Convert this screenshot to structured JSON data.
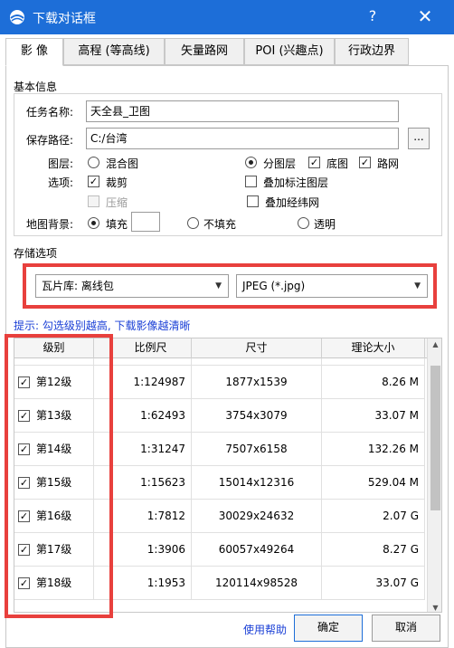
{
  "window": {
    "title": "下载对话框",
    "help": "?",
    "close": "✕",
    "accent": "#1d6ed8"
  },
  "tabs": [
    {
      "label": "影 像",
      "active": true
    },
    {
      "label": "高程 (等高线)",
      "active": false
    },
    {
      "label": "矢量路网",
      "active": false
    },
    {
      "label": "POI (兴趣点)",
      "active": false
    },
    {
      "label": "行政边界",
      "active": false
    }
  ],
  "basic": {
    "title": "基本信息",
    "task_label": "任务名称:",
    "task_value": "天全县_卫图",
    "path_label": "保存路径:",
    "path_value": "C:/台湾",
    "browse_label": "...",
    "layer_label": "图层:",
    "layer_mixed": "混合图",
    "layer_split": "分图层",
    "layer_base": "底图",
    "layer_road": "路网",
    "option_label": "选项:",
    "opt_crop": "裁剪",
    "opt_overlay": "叠加标注图层",
    "opt_compress": "压缩",
    "opt_grid": "叠加经纬网",
    "bg_label": "地图背景:",
    "bg_fill": "填充",
    "bg_nofill": "不填充",
    "bg_transparent": "透明"
  },
  "storage": {
    "title": "存储选项",
    "format_value": "瓦片库: 离线包",
    "image_type_value": "JPEG (*.jpg)"
  },
  "hint": "提示: 勾选级别越高, 下载影像越清晰",
  "grid": {
    "headers": [
      "级别",
      "比例尺",
      "尺寸",
      "理论大小"
    ],
    "rows": [
      {
        "level": "第12级",
        "scale": "1:124987",
        "size": "1877x1539",
        "theory": "8.26 M",
        "checked": true
      },
      {
        "level": "第13级",
        "scale": "1:62493",
        "size": "3754x3079",
        "theory": "33.07 M",
        "checked": true
      },
      {
        "level": "第14级",
        "scale": "1:31247",
        "size": "7507x6158",
        "theory": "132.26 M",
        "checked": true
      },
      {
        "level": "第15级",
        "scale": "1:15623",
        "size": "15014x12316",
        "theory": "529.04 M",
        "checked": true
      },
      {
        "level": "第16级",
        "scale": "1:7812",
        "size": "30029x24632",
        "theory": "2.07 G",
        "checked": true
      },
      {
        "level": "第17级",
        "scale": "1:3906",
        "size": "60057x49264",
        "theory": "8.27 G",
        "checked": true
      },
      {
        "level": "第18级",
        "scale": "1:1953",
        "size": "120114x98528",
        "theory": "33.07 G",
        "checked": true
      }
    ]
  },
  "footer": {
    "link_label": "使用帮助",
    "ok_label": "确定",
    "cancel_label": "取消"
  },
  "annotation_color": "#e8403d"
}
